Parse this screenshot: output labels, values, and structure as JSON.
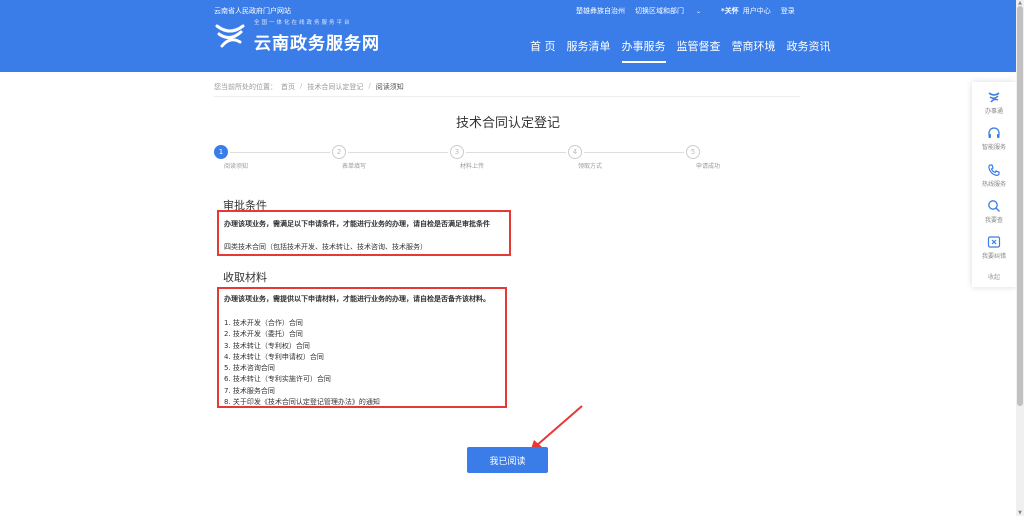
{
  "header": {
    "top_left_link": "云南省人民政府门户网站",
    "region": "楚雄彝族自治州",
    "switch_region": "切换区域和部门",
    "care_mode": "*关怀",
    "user_center": "用户中心",
    "login": "登录",
    "logo_tagline": "全国一体化在线政务服务平台",
    "logo_title": "云南政务服务网",
    "nav": [
      {
        "label": "首 页"
      },
      {
        "label": "服务清单"
      },
      {
        "label": "办事服务"
      },
      {
        "label": "监管督查"
      },
      {
        "label": "营商环境"
      },
      {
        "label": "政务资讯"
      }
    ]
  },
  "breadcrumb": {
    "prefix": "您当前所处的位置：",
    "items": [
      "首页",
      "技术合同认定登记",
      "阅读须知"
    ]
  },
  "page_title": "技术合同认定登记",
  "steps": [
    {
      "num": "1",
      "label": "阅读须知"
    },
    {
      "num": "2",
      "label": "表单填写"
    },
    {
      "num": "3",
      "label": "材料上传"
    },
    {
      "num": "4",
      "label": "领取方式"
    },
    {
      "num": "5",
      "label": "申请成功"
    }
  ],
  "approval": {
    "title": "审批条件",
    "intro": "办理该项业务，需满足以下申请条件，才能进行业务的办理，请自检是否满足审批条件",
    "item": "四类技术合同（包括技术开发、技术转让、技术咨询、技术服务）"
  },
  "materials": {
    "title": "收取材料",
    "intro": "办理该项业务，需提供以下申请材料，才能进行业务的办理，请自检是否备齐该材料。",
    "items": [
      "1. 技术开发（合作）合同",
      "2. 技术开发（委托）合同",
      "3. 技术转让（专利权）合同",
      "4. 技术转让（专利申请权）合同",
      "5. 技术咨询合同",
      "6. 技术转让（专利实施许可）合同",
      "7. 技术服务合同",
      "8. 关于印发《技术合同认定登记管理办法》的通知"
    ]
  },
  "read_button": "我已阅读",
  "sidebar": {
    "items": [
      {
        "label": "办事通",
        "icon": "service-app-icon"
      },
      {
        "label": "智能服务",
        "icon": "headset-icon"
      },
      {
        "label": "热线服务",
        "icon": "phone-icon"
      },
      {
        "label": "我要查",
        "icon": "search-icon"
      },
      {
        "label": "我要纠错",
        "icon": "close-box-icon"
      }
    ],
    "collapse": "收起"
  },
  "colors": {
    "primary": "#3a7ce8",
    "highlight_border": "#e53935"
  }
}
